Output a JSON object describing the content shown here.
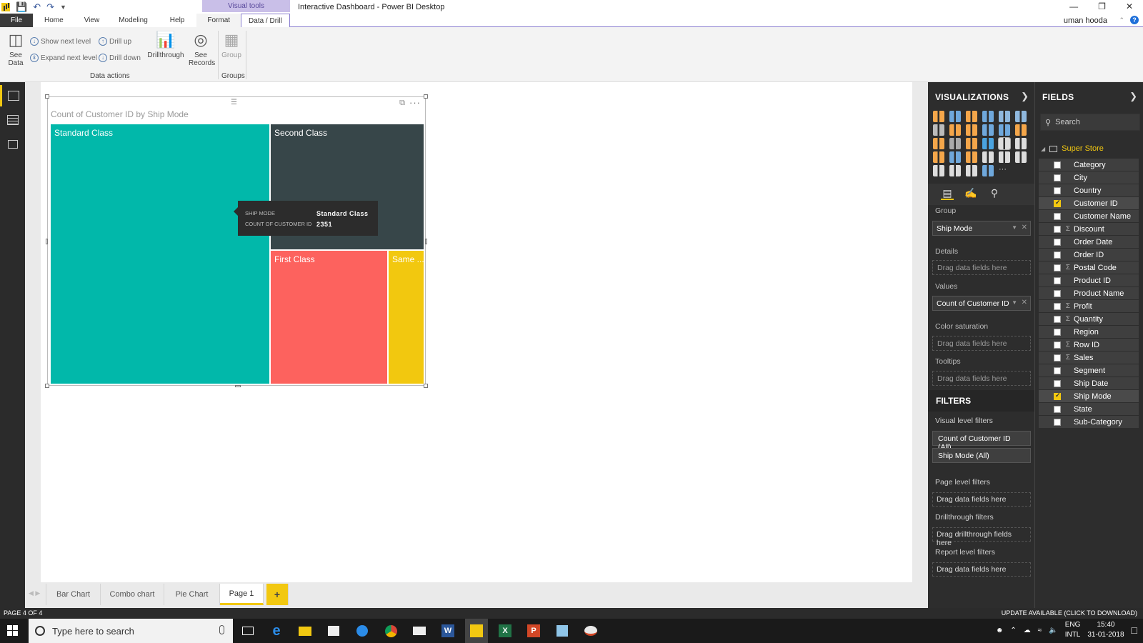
{
  "app": {
    "title": "Interactive Dashboard - Power BI Desktop",
    "context_tab": "Visual tools",
    "user": "uman hooda"
  },
  "menu_tabs": [
    "File",
    "Home",
    "View",
    "Modeling",
    "Help",
    "Format",
    "Data / Drill"
  ],
  "ribbon": {
    "see_data": "See Data",
    "show_next_level": "Show next level",
    "expand_next_level": "Expand next level",
    "drill_up": "Drill up",
    "drill_down": "Drill down",
    "drillthrough": "Drillthrough",
    "see_records": "See Records",
    "group": "Group",
    "group_label_data_actions": "Data actions",
    "group_label_groups": "Groups"
  },
  "visual": {
    "title": "Count of Customer ID by Ship Mode",
    "tooltip": {
      "k1": "SHIP MODE",
      "v1": "Standard Class",
      "k2": "COUNT OF CUSTOMER ID",
      "v2": "2351"
    }
  },
  "chart_data": {
    "type": "treemap",
    "title": "Count of Customer ID by Ship Mode",
    "categories": [
      "Standard Class",
      "Second Class",
      "First Class",
      "Same ..."
    ],
    "values": [
      2351,
      null,
      null,
      null
    ],
    "colors": [
      "#01b8aa",
      "#374649",
      "#fd625e",
      "#f2c80f"
    ]
  },
  "page_tabs": [
    "Bar Chart",
    "Combo chart",
    "Pie Chart",
    "Page 1",
    "+"
  ],
  "active_page": "Page 1",
  "visualizations": {
    "header": "VISUALIZATIONS",
    "wells": {
      "group_label": "Group",
      "group_value": "Ship Mode",
      "details_label": "Details",
      "details_drop": "Drag data fields here",
      "values_label": "Values",
      "values_value": "Count of Customer ID",
      "color_label": "Color saturation",
      "color_drop": "Drag data fields here",
      "tooltips_label": "Tooltips",
      "tooltips_drop": "Drag data fields here"
    }
  },
  "filters": {
    "header": "FILTERS",
    "visual_level": "Visual level filters",
    "chip1": "Count of Customer ID (All)",
    "chip2": "Ship Mode (All)",
    "page_level": "Page level filters",
    "page_drop": "Drag data fields here",
    "drillthrough_label": "Drillthrough filters",
    "drillthrough_drop": "Drag drillthrough fields here",
    "report_level": "Report level filters",
    "report_drop": "Drag data fields here"
  },
  "fields": {
    "header": "FIELDS",
    "search_placeholder": "Search",
    "table": "Super Store",
    "items": [
      {
        "name": "Category",
        "sigma": false,
        "checked": false
      },
      {
        "name": "City",
        "sigma": false,
        "checked": false
      },
      {
        "name": "Country",
        "sigma": false,
        "checked": false
      },
      {
        "name": "Customer ID",
        "sigma": false,
        "checked": true
      },
      {
        "name": "Customer Name",
        "sigma": false,
        "checked": false
      },
      {
        "name": "Discount",
        "sigma": true,
        "checked": false
      },
      {
        "name": "Order Date",
        "sigma": false,
        "checked": false
      },
      {
        "name": "Order ID",
        "sigma": false,
        "checked": false
      },
      {
        "name": "Postal Code",
        "sigma": true,
        "checked": false
      },
      {
        "name": "Product ID",
        "sigma": false,
        "checked": false
      },
      {
        "name": "Product Name",
        "sigma": false,
        "checked": false
      },
      {
        "name": "Profit",
        "sigma": true,
        "checked": false
      },
      {
        "name": "Quantity",
        "sigma": true,
        "checked": false
      },
      {
        "name": "Region",
        "sigma": false,
        "checked": false
      },
      {
        "name": "Row ID",
        "sigma": true,
        "checked": false
      },
      {
        "name": "Sales",
        "sigma": true,
        "checked": false
      },
      {
        "name": "Segment",
        "sigma": false,
        "checked": false
      },
      {
        "name": "Ship Date",
        "sigma": false,
        "checked": false
      },
      {
        "name": "Ship Mode",
        "sigma": false,
        "checked": true
      },
      {
        "name": "State",
        "sigma": false,
        "checked": false
      },
      {
        "name": "Sub-Category",
        "sigma": false,
        "checked": false
      }
    ]
  },
  "status": {
    "page": "PAGE 4 OF 4",
    "update": "UPDATE AVAILABLE (CLICK TO DOWNLOAD)"
  },
  "taskbar": {
    "search_placeholder": "Type here to search",
    "lang1": "ENG",
    "lang2": "INTL",
    "time": "15:40",
    "date": "31-01-2018"
  }
}
